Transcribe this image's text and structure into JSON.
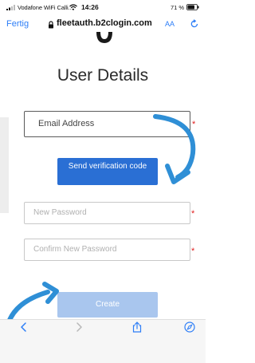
{
  "status_bar": {
    "carrier": "Vodafone WiFi Calli...",
    "time": "14:26",
    "battery": "71 %"
  },
  "address_bar": {
    "done_label": "Fertig",
    "url": "fleetauth.b2clogin.com",
    "text_size_label": "AA"
  },
  "form": {
    "title": "User Details",
    "email_placeholder": "Email Address",
    "send_code_label": "Send verification code",
    "new_password_placeholder": "New Password",
    "confirm_password_placeholder": "Confirm New Password",
    "create_label": "Create",
    "required_marker": "*"
  },
  "colors": {
    "accent": "#2a6fd4",
    "disabled_button": "#a9c6ee",
    "arrow": "#2f8fd6",
    "required": "#e02020",
    "safari_blue": "#2d7ef7"
  },
  "toolbar": {
    "icons": [
      "back-icon",
      "forward-icon",
      "share-icon",
      "compass-icon"
    ]
  }
}
